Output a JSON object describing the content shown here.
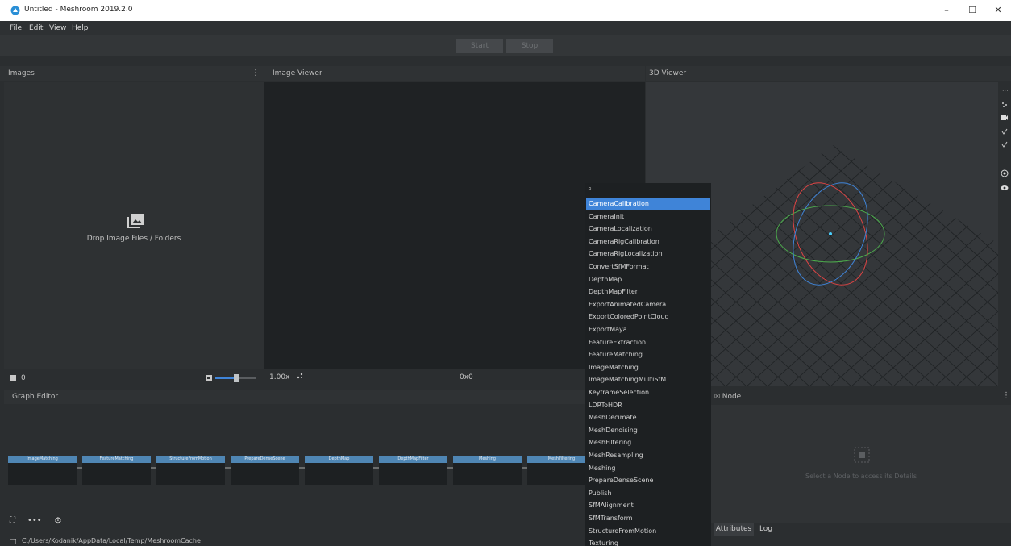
{
  "window": {
    "title": "Untitled - Meshroom 2019.2.0",
    "minimize": "–",
    "maximize": "☐",
    "close": "✕"
  },
  "menu": [
    "File",
    "Edit",
    "View",
    "Help"
  ],
  "toolbar": {
    "start_label": "Start",
    "stop_label": "Stop"
  },
  "images": {
    "title": "Images",
    "menu_glyph": "⋮",
    "drop_text": "Drop Image Files / Folders",
    "count": "0"
  },
  "image_viewer": {
    "title": "Image Viewer",
    "zoom": "1.00x",
    "resolution": "0x0"
  },
  "viewer3d": {
    "title": "3D Viewer"
  },
  "graph_editor": {
    "title": "Graph Editor",
    "nodes": [
      "ImageMatching",
      "FeatureMatching",
      "StructureFromMotion",
      "PrepareDenseScene",
      "DepthMap",
      "DepthMapFilter",
      "Meshing",
      "MeshFiltering"
    ]
  },
  "node_panel": {
    "title": "Node",
    "placeholder": "Select a Node to access its Details",
    "tabs": [
      "Attributes",
      "Log"
    ]
  },
  "dropdown": {
    "search_glyph": "⌕",
    "items": [
      "CameraCalibration",
      "CameraInit",
      "CameraLocalization",
      "CameraRigCalibration",
      "CameraRigLocalization",
      "ConvertSfMFormat",
      "DepthMap",
      "DepthMapFilter",
      "ExportAnimatedCamera",
      "ExportColoredPointCloud",
      "ExportMaya",
      "FeatureExtraction",
      "FeatureMatching",
      "ImageMatching",
      "ImageMatchingMultiSfM",
      "KeyframeSelection",
      "LDRToHDR",
      "MeshDecimate",
      "MeshDenoising",
      "MeshFiltering",
      "MeshResampling",
      "Meshing",
      "PrepareDenseScene",
      "Publish",
      "SfMAlignment",
      "SfMTransform",
      "StructureFromMotion",
      "Texturing"
    ],
    "selected_index": 0
  },
  "status": {
    "path": "C:/Users/Kodanik/AppData/Local/Temp/MeshroomCache"
  },
  "colors": {
    "accent": "#3f84d8",
    "node_header": "#4f86b4"
  }
}
